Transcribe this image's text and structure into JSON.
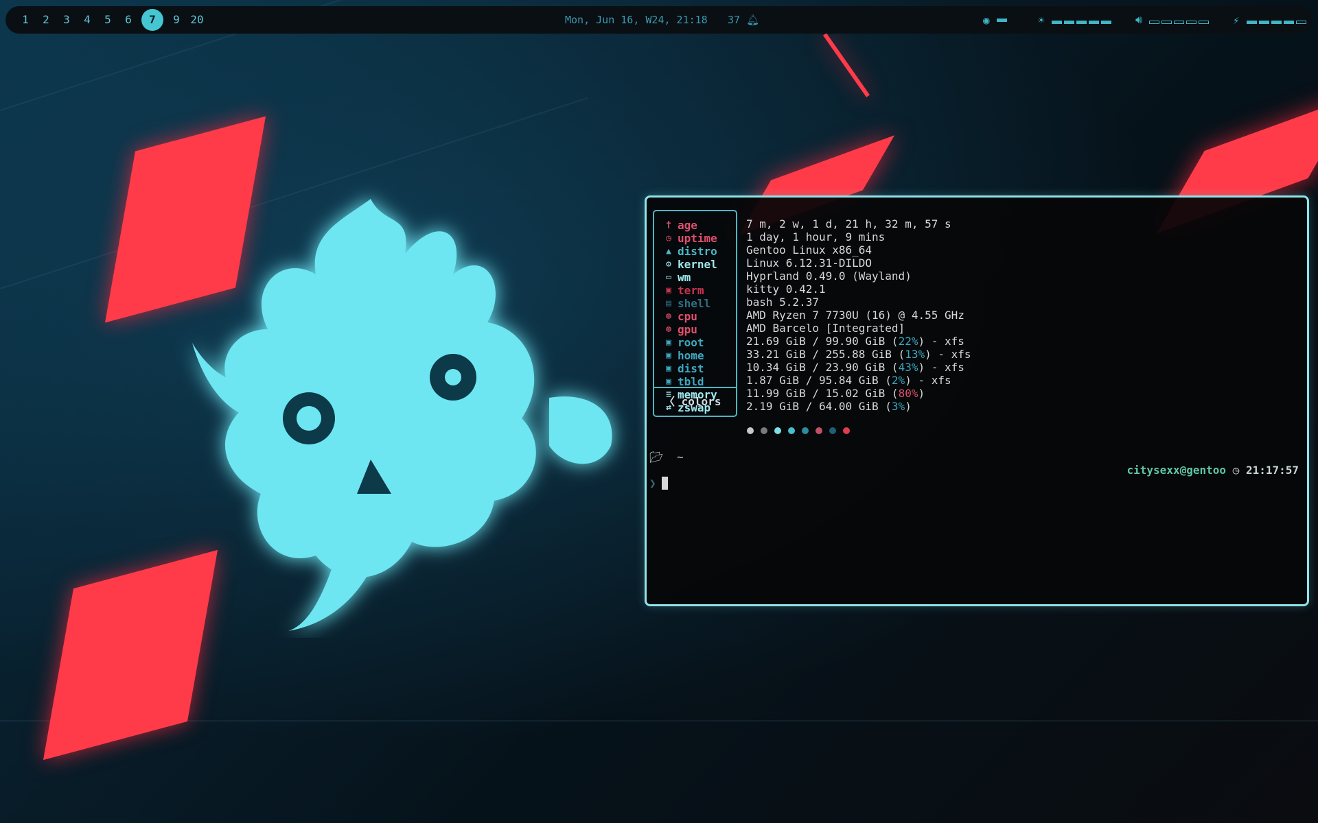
{
  "topbar": {
    "workspaces": [
      {
        "label": "1",
        "active": false
      },
      {
        "label": "2",
        "active": false
      },
      {
        "label": "3",
        "active": false
      },
      {
        "label": "4",
        "active": false
      },
      {
        "label": "5",
        "active": false
      },
      {
        "label": "6",
        "active": false
      },
      {
        "label": "7",
        "active": true
      },
      {
        "label": "9",
        "active": false
      },
      {
        "label": "20",
        "active": false
      }
    ],
    "clock": "Mon, Jun 16, W24, 21:18",
    "notifications": "37",
    "tray": {
      "visibility_icon": "eye-icon",
      "brightness_icon": "sun-icon",
      "volume_icon": "speaker-icon",
      "battery_icon": "bolt-icon",
      "brightness_level": 1.0,
      "volume_level": 0.0,
      "battery_level": 0.8
    }
  },
  "terminal": {
    "fetch": [
      {
        "key": "age",
        "icon": "person-icon",
        "color": "#e0506e",
        "value": "7 m, 2 w, 1 d, 21 h, 32 m, 57 s"
      },
      {
        "key": "uptime",
        "icon": "clock-icon",
        "color": "#e0506e",
        "value": "1 day, 1 hour, 9 mins"
      },
      {
        "key": "distro",
        "icon": "linux-icon",
        "color": "#4cb8c8",
        "value": "Gentoo Linux x86_64"
      },
      {
        "key": "kernel",
        "icon": "gear-icon",
        "color": "#a0e8f0",
        "value": "Linux 6.12.31-DILDO"
      },
      {
        "key": "wm",
        "icon": "monitor-icon",
        "color": "#a0e8f0",
        "value": "Hyprland 0.49.0 (Wayland)"
      },
      {
        "key": "term",
        "icon": "terminal-icon",
        "color": "#c8344e",
        "value": "kitty 0.42.1"
      },
      {
        "key": "shell",
        "icon": "shell-icon",
        "color": "#2f6f86",
        "value": "bash 5.2.37"
      },
      {
        "key": "cpu",
        "icon": "chip-icon",
        "color": "#e0506e",
        "value": "AMD Ryzen 7 7730U (16) @ 4.55 GHz"
      },
      {
        "key": "gpu",
        "icon": "chip-icon",
        "color": "#e0506e",
        "value": "AMD Barcelo [Integrated]"
      },
      {
        "key": "root",
        "icon": "disk-icon",
        "color": "#3ea8c0",
        "value": "21.69 GiB / 99.90 GiB (",
        "pct": "22%",
        "pct_color": "#3ea8c0",
        "suffix": ") - xfs"
      },
      {
        "key": "home",
        "icon": "disk-icon",
        "color": "#3ea8c0",
        "value": "33.21 GiB / 255.88 GiB (",
        "pct": "13%",
        "pct_color": "#3ea8c0",
        "suffix": ") - xfs"
      },
      {
        "key": "dist",
        "icon": "disk-icon",
        "color": "#3ea8c0",
        "value": "10.34 GiB / 23.90 GiB (",
        "pct": "43%",
        "pct_color": "#3ea8c0",
        "suffix": ") - xfs"
      },
      {
        "key": "tbld",
        "icon": "disk-icon",
        "color": "#3ea8c0",
        "value": "1.87 GiB / 95.84 GiB (",
        "pct": "2%",
        "pct_color": "#3ea8c0",
        "suffix": ") - xfs"
      },
      {
        "key": "memory",
        "icon": "memory-icon",
        "color": "#a0e8f0",
        "value": "11.99 GiB / 15.02 GiB (",
        "pct": "80%",
        "pct_color": "#e0506e",
        "suffix": ")"
      },
      {
        "key": "zswap",
        "icon": "swap-icon",
        "color": "#a0e8f0",
        "value": "2.19 GiB / 64.00 GiB (",
        "pct": "3%",
        "pct_color": "#3ea8c0",
        "suffix": ")"
      }
    ],
    "colors_label": "colors",
    "palette": [
      "#c8c8c8",
      "#7a7a7a",
      "#7ee0e6",
      "#45c0cc",
      "#2f8aa0",
      "#c0506a",
      "#1e5f78",
      "#e03c50"
    ],
    "cwd": "~",
    "prompt_user": "citysexx@gentoo",
    "prompt_time": "21:17:57",
    "prompt_symbol": "❯"
  }
}
